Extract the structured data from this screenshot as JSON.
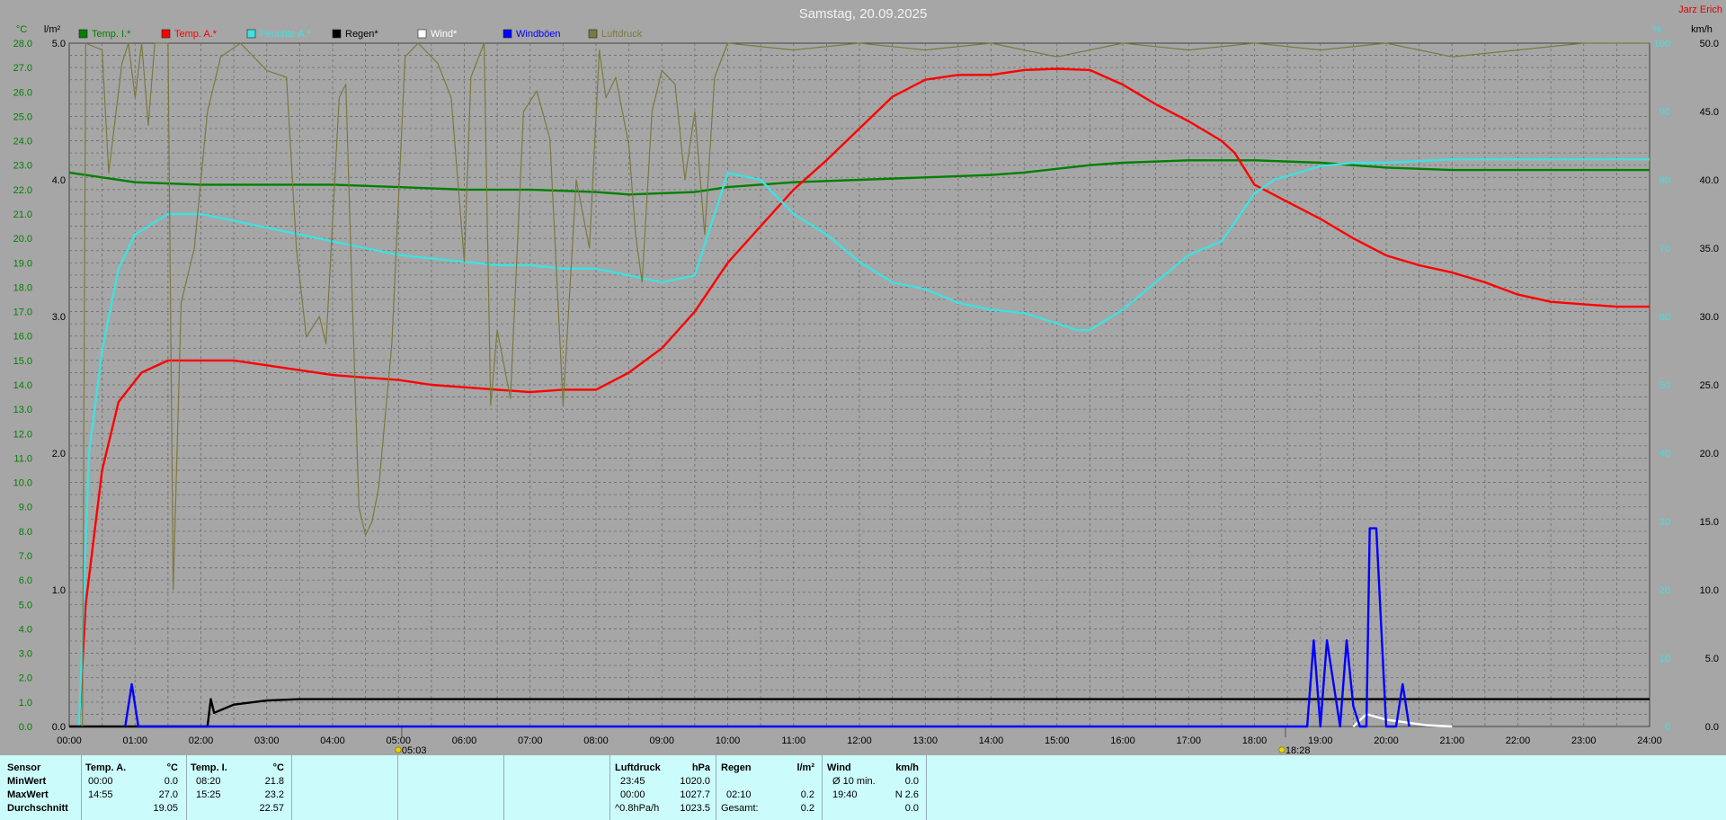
{
  "author": "Jarz Erich",
  "chart_data": {
    "type": "line",
    "title": "Samstag, 20.09.2025",
    "x_ticks": [
      "00:00",
      "01:00",
      "02:00",
      "03:00",
      "04:00",
      "05:00",
      "06:00",
      "07:00",
      "08:00",
      "09:00",
      "10:00",
      "11:00",
      "12:00",
      "13:00",
      "14:00",
      "15:00",
      "16:00",
      "17:00",
      "18:00",
      "19:00",
      "20:00",
      "21:00",
      "22:00",
      "23:00",
      "24:00"
    ],
    "axes": {
      "temp": {
        "unit": "°C",
        "min": 0,
        "max": 28,
        "step": 1,
        "color": "#008000"
      },
      "rain": {
        "unit": "l/m²",
        "min": 0,
        "max": 5,
        "step": 1,
        "color": "#000000"
      },
      "percent": {
        "unit": "%",
        "min": 0,
        "max": 100,
        "step": 10,
        "color": "#40e0e0"
      },
      "wind": {
        "unit": "km/h",
        "min": 0,
        "max": 50,
        "step": 5,
        "color": "#000000"
      }
    },
    "markers": [
      {
        "label": "05:03",
        "x": 5.05
      },
      {
        "label": "18:28",
        "x": 18.47
      }
    ],
    "grid": true,
    "legend_position": "top",
    "series": [
      {
        "name": "Temp. I.*",
        "color": "#008000",
        "axis": "temp",
        "points": [
          [
            0,
            22.7
          ],
          [
            1,
            22.3
          ],
          [
            2,
            22.2
          ],
          [
            3,
            22.2
          ],
          [
            4,
            22.2
          ],
          [
            5,
            22.1
          ],
          [
            6,
            22.0
          ],
          [
            7,
            22.0
          ],
          [
            8,
            21.9
          ],
          [
            8.5,
            21.8
          ],
          [
            9.5,
            21.9
          ],
          [
            10,
            22.1
          ],
          [
            11,
            22.3
          ],
          [
            12,
            22.4
          ],
          [
            13,
            22.5
          ],
          [
            14,
            22.6
          ],
          [
            14.5,
            22.7
          ],
          [
            15.5,
            23.0
          ],
          [
            16,
            23.1
          ],
          [
            17,
            23.2
          ],
          [
            18,
            23.2
          ],
          [
            19,
            23.1
          ],
          [
            20,
            22.9
          ],
          [
            21,
            22.8
          ],
          [
            22,
            22.8
          ],
          [
            23,
            22.8
          ],
          [
            24,
            22.8
          ]
        ]
      },
      {
        "name": "Temp. A.*",
        "color": "#ff0000",
        "axis": "temp",
        "points": [
          [
            0.15,
            0
          ],
          [
            0.25,
            5
          ],
          [
            0.5,
            10.5
          ],
          [
            0.75,
            13.3
          ],
          [
            1.1,
            14.5
          ],
          [
            1.5,
            15.0
          ],
          [
            2,
            15.0
          ],
          [
            2.5,
            15.0
          ],
          [
            3,
            14.8
          ],
          [
            3.5,
            14.6
          ],
          [
            4,
            14.4
          ],
          [
            4.5,
            14.3
          ],
          [
            5,
            14.2
          ],
          [
            5.5,
            14.0
          ],
          [
            6,
            13.9
          ],
          [
            6.5,
            13.8
          ],
          [
            7,
            13.7
          ],
          [
            7.5,
            13.8
          ],
          [
            8,
            13.8
          ],
          [
            8.5,
            14.5
          ],
          [
            9,
            15.5
          ],
          [
            9.5,
            17.0
          ],
          [
            10,
            19.0
          ],
          [
            10.5,
            20.5
          ],
          [
            11,
            22.0
          ],
          [
            11.5,
            23.2
          ],
          [
            12,
            24.5
          ],
          [
            12.5,
            25.8
          ],
          [
            13,
            26.5
          ],
          [
            13.5,
            26.7
          ],
          [
            14,
            26.7
          ],
          [
            14.5,
            26.9
          ],
          [
            15,
            26.95
          ],
          [
            15.5,
            26.9
          ],
          [
            16,
            26.3
          ],
          [
            16.5,
            25.5
          ],
          [
            17,
            24.8
          ],
          [
            17.5,
            24.0
          ],
          [
            17.7,
            23.5
          ],
          [
            18,
            22.2
          ],
          [
            18.5,
            21.5
          ],
          [
            19,
            20.8
          ],
          [
            19.5,
            20.0
          ],
          [
            20,
            19.3
          ],
          [
            20.5,
            18.9
          ],
          [
            21,
            18.6
          ],
          [
            21.5,
            18.2
          ],
          [
            22,
            17.7
          ],
          [
            22.5,
            17.4
          ],
          [
            23,
            17.3
          ],
          [
            23.5,
            17.2
          ],
          [
            24,
            17.2
          ]
        ]
      },
      {
        "name": "Feuchte A.*",
        "color": "#40e0e0",
        "axis": "percent",
        "points": [
          [
            0.15,
            0
          ],
          [
            0.3,
            40
          ],
          [
            0.5,
            55
          ],
          [
            0.75,
            67
          ],
          [
            1,
            72
          ],
          [
            1.5,
            75
          ],
          [
            2,
            75
          ],
          [
            2.5,
            74
          ],
          [
            3,
            73
          ],
          [
            3.5,
            72
          ],
          [
            4,
            71
          ],
          [
            4.5,
            70
          ],
          [
            5,
            69
          ],
          [
            5.5,
            68.5
          ],
          [
            6,
            68
          ],
          [
            6.5,
            67.5
          ],
          [
            7,
            67.5
          ],
          [
            7.5,
            67
          ],
          [
            8,
            67
          ],
          [
            8.5,
            66
          ],
          [
            9,
            65
          ],
          [
            9.5,
            66
          ],
          [
            10,
            81
          ],
          [
            10.5,
            80
          ],
          [
            11,
            75
          ],
          [
            11.5,
            72
          ],
          [
            12,
            68
          ],
          [
            12.5,
            65
          ],
          [
            13,
            64
          ],
          [
            13.5,
            62
          ],
          [
            14,
            61
          ],
          [
            14.5,
            60.5
          ],
          [
            15,
            59
          ],
          [
            15.3,
            58
          ],
          [
            15.5,
            58
          ],
          [
            16,
            61
          ],
          [
            16.5,
            65
          ],
          [
            17,
            69
          ],
          [
            17.5,
            71
          ],
          [
            18,
            78
          ],
          [
            18.3,
            80
          ],
          [
            19,
            82
          ],
          [
            19.5,
            82.5
          ],
          [
            20,
            82.5
          ],
          [
            21,
            83
          ],
          [
            22,
            83
          ],
          [
            23,
            83
          ],
          [
            24,
            83
          ]
        ]
      },
      {
        "name": "Regen*",
        "color": "#000000",
        "axis": "rain",
        "points": [
          [
            0,
            0
          ],
          [
            2.1,
            0
          ],
          [
            2.15,
            0.2
          ],
          [
            2.2,
            0.1
          ],
          [
            2.5,
            0.16
          ],
          [
            3,
            0.19
          ],
          [
            3.5,
            0.2
          ],
          [
            24,
            0.2
          ]
        ]
      },
      {
        "name": "Wind*",
        "color": "#ffffff",
        "axis": "wind",
        "points": [
          [
            19.5,
            0
          ],
          [
            19.7,
            0.9
          ],
          [
            20,
            0.5
          ],
          [
            20.3,
            0.3
          ],
          [
            20.6,
            0.1
          ],
          [
            21,
            0
          ]
        ]
      },
      {
        "name": "Windböen",
        "color": "#0000ff",
        "axis": "wind",
        "points": [
          [
            0.85,
            0
          ],
          [
            0.95,
            3.1
          ],
          [
            1.05,
            0
          ],
          [
            18.8,
            0
          ],
          [
            18.9,
            6.3
          ],
          [
            19,
            0
          ],
          [
            19.1,
            6.3
          ],
          [
            19.3,
            0
          ],
          [
            19.4,
            6.3
          ],
          [
            19.5,
            1.5
          ],
          [
            19.6,
            0
          ],
          [
            19.7,
            0
          ],
          [
            19.75,
            14.5
          ],
          [
            19.85,
            14.5
          ],
          [
            20,
            0
          ],
          [
            20.15,
            0
          ],
          [
            20.25,
            3.1
          ],
          [
            20.35,
            0
          ]
        ]
      },
      {
        "name": "Luftdruck",
        "color": "#7a7a40",
        "axis": "percent",
        "points": [
          [
            0.2,
            0
          ],
          [
            0.25,
            100
          ],
          [
            0.5,
            99
          ],
          [
            0.6,
            81
          ],
          [
            0.8,
            97
          ],
          [
            0.9,
            100
          ],
          [
            1,
            92
          ],
          [
            1.1,
            100
          ],
          [
            1.2,
            88
          ],
          [
            1.3,
            100
          ],
          [
            1.5,
            100
          ],
          [
            1.58,
            20
          ],
          [
            1.7,
            62
          ],
          [
            1.9,
            70
          ],
          [
            2.1,
            90
          ],
          [
            2.3,
            98
          ],
          [
            2.6,
            100
          ],
          [
            3,
            96
          ],
          [
            3.3,
            95
          ],
          [
            3.45,
            70
          ],
          [
            3.6,
            57
          ],
          [
            3.8,
            60
          ],
          [
            3.9,
            56
          ],
          [
            4.1,
            92
          ],
          [
            4.2,
            94
          ],
          [
            4.3,
            62
          ],
          [
            4.4,
            32
          ],
          [
            4.5,
            28
          ],
          [
            4.6,
            30
          ],
          [
            4.7,
            35
          ],
          [
            4.9,
            56
          ],
          [
            5.1,
            98
          ],
          [
            5.3,
            100
          ],
          [
            5.6,
            97
          ],
          [
            5.8,
            92
          ],
          [
            6.0,
            68
          ],
          [
            6.1,
            95
          ],
          [
            6.3,
            100
          ],
          [
            6.4,
            47
          ],
          [
            6.5,
            58
          ],
          [
            6.7,
            48
          ],
          [
            6.9,
            90
          ],
          [
            7.1,
            93
          ],
          [
            7.3,
            86
          ],
          [
            7.5,
            47
          ],
          [
            7.7,
            80
          ],
          [
            7.9,
            70
          ],
          [
            8.05,
            99
          ],
          [
            8.15,
            92
          ],
          [
            8.3,
            95
          ],
          [
            8.5,
            85
          ],
          [
            8.6,
            72
          ],
          [
            8.7,
            65
          ],
          [
            8.85,
            90
          ],
          [
            9.0,
            96
          ],
          [
            9.2,
            94
          ],
          [
            9.35,
            80
          ],
          [
            9.5,
            90
          ],
          [
            9.65,
            72
          ],
          [
            9.8,
            95
          ],
          [
            10,
            100
          ],
          [
            11,
            99
          ],
          [
            12,
            100
          ],
          [
            13,
            99
          ],
          [
            14,
            100
          ],
          [
            15,
            98
          ],
          [
            16,
            100
          ],
          [
            17,
            99
          ],
          [
            18,
            100
          ],
          [
            19,
            99
          ],
          [
            20,
            100
          ],
          [
            21,
            98
          ],
          [
            22,
            99
          ],
          [
            23,
            100
          ],
          [
            24,
            100
          ]
        ]
      }
    ]
  },
  "footer": {
    "col_sensor": {
      "header": "Sensor",
      "rows": [
        "MinWert",
        "MaxWert",
        "Durchschnitt"
      ]
    },
    "temp_a": {
      "header": "Temp. A.",
      "unit": "°C",
      "min_time": "00:00",
      "min_val": "0.0",
      "max_time": "14:55",
      "max_val": "27.0",
      "avg": "19.05"
    },
    "temp_i": {
      "header": "Temp. I.",
      "unit": "°C",
      "min_time": "08:20",
      "min_val": "21.8",
      "max_time": "15:25",
      "max_val": "23.2",
      "avg": "22.57"
    },
    "luftdruck": {
      "header": "Luftdruck",
      "unit": "hPa",
      "min_time": "23:45",
      "min_val": "1020.0",
      "max_time": "00:00",
      "max_val": "1027.7",
      "trend": "^0.8hPa/h",
      "trend_val": "1023.5"
    },
    "regen": {
      "header": "Regen",
      "unit": "l/m²",
      "max_time": "02:10",
      "max_val": "0.2",
      "total_label": "Gesamt:",
      "total_val": "0.2"
    },
    "wind": {
      "header": "Wind",
      "unit": "km/h",
      "avg_label": "Ø 10 min.",
      "avg_val": "0.0",
      "max_time": "19:40",
      "max_val": "N 2.6",
      "last_val": "0.0"
    }
  }
}
